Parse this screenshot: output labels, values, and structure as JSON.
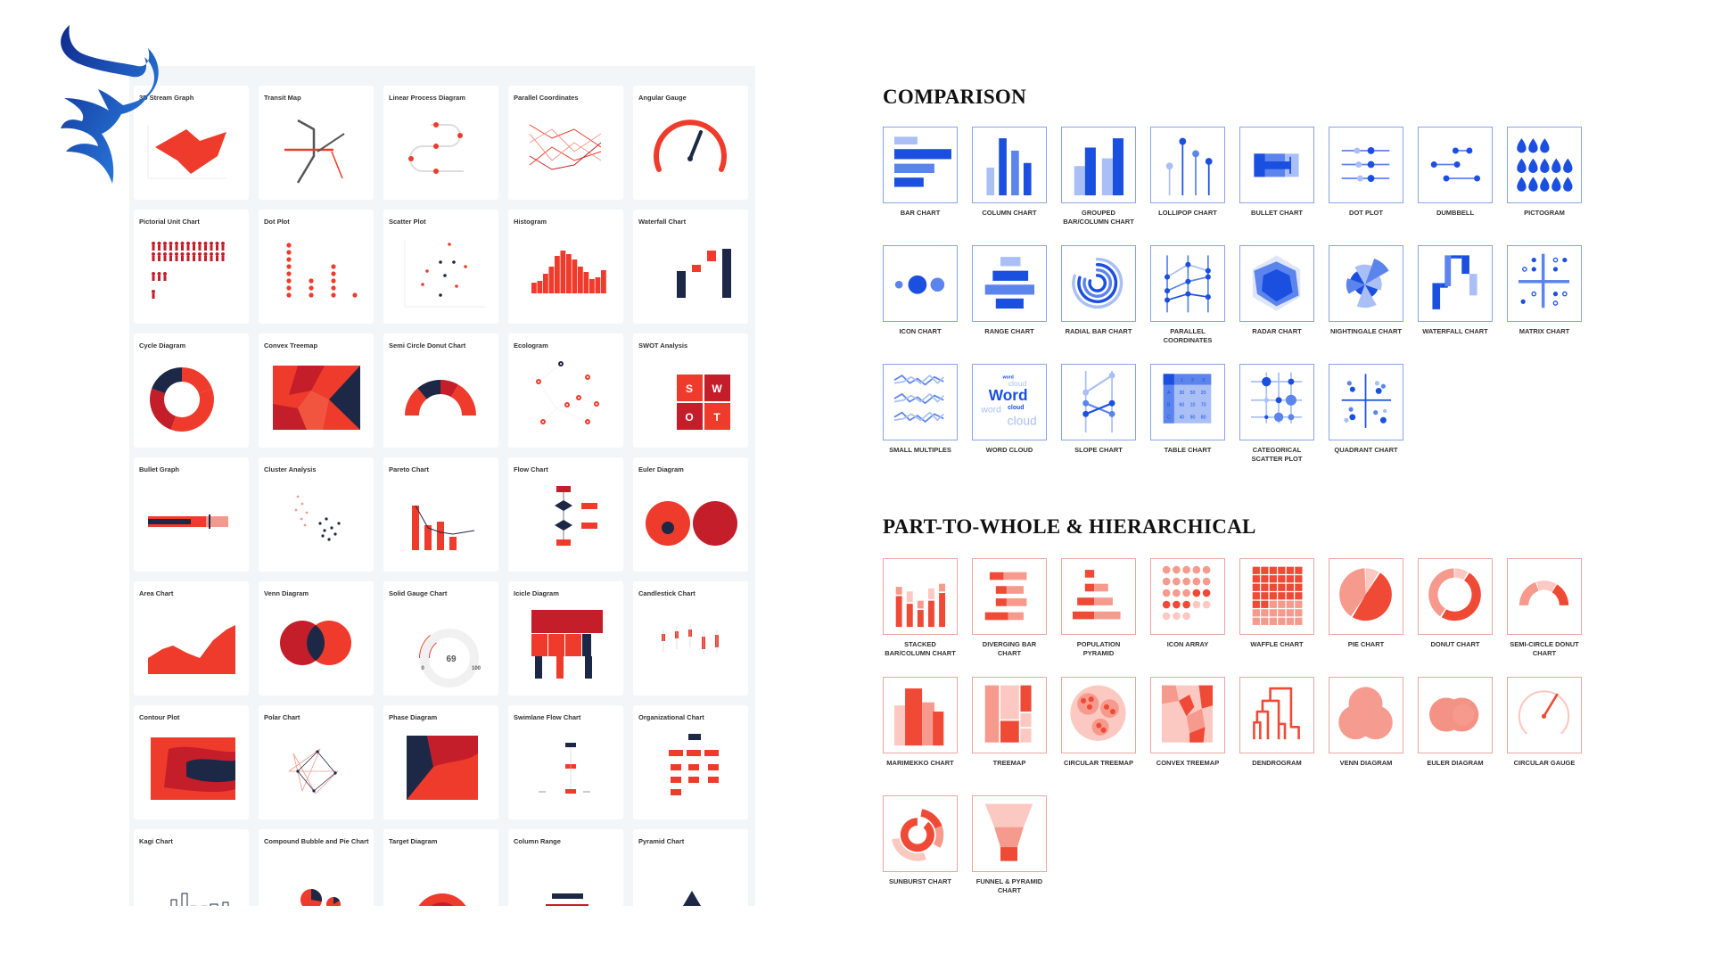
{
  "logo": {
    "icon": "blue-bull-flame-logo",
    "color_dark": "#0f2a8c",
    "color_light": "#2f8cf0"
  },
  "colors": {
    "red": "#ee3b2b",
    "dark_red": "#c41e2a",
    "navy": "#1d2846",
    "blue": "#1a4fe0",
    "blue_mid": "#5b84ec",
    "blue_light": "#a9bff5",
    "coral": "#ef4a36",
    "coral_mid": "#f59a8c",
    "coral_light": "#fbc9c1"
  },
  "gallery": {
    "cards": [
      {
        "title": "3D Stream Graph",
        "icon": "3d-stream"
      },
      {
        "title": "Transit Map",
        "icon": "transit"
      },
      {
        "title": "Linear Process Diagram",
        "icon": "linear-process"
      },
      {
        "title": "Parallel Coordinates",
        "icon": "parallel"
      },
      {
        "title": "Angular Gauge",
        "icon": "angular-gauge"
      },
      {
        "title": "Pictorial Unit Chart",
        "icon": "pictorial"
      },
      {
        "title": "Dot Plot",
        "icon": "dotplot"
      },
      {
        "title": "Scatter Plot",
        "icon": "scatter"
      },
      {
        "title": "Histogram",
        "icon": "histogram"
      },
      {
        "title": "Waterfall Chart",
        "icon": "waterfall"
      },
      {
        "title": "Cycle Diagram",
        "icon": "cycle"
      },
      {
        "title": "Convex Treemap",
        "icon": "convex"
      },
      {
        "title": "Semi Circle Donut Chart",
        "icon": "semidonut"
      },
      {
        "title": "Ecologram",
        "icon": "ecologram"
      },
      {
        "title": "SWOT Analysis",
        "icon": "swot",
        "text": [
          "S",
          "W",
          "O",
          "T"
        ]
      },
      {
        "title": "Bullet Graph",
        "icon": "bullet"
      },
      {
        "title": "Cluster Analysis",
        "icon": "cluster"
      },
      {
        "title": "Pareto Chart",
        "icon": "pareto"
      },
      {
        "title": "Flow Chart",
        "icon": "flow"
      },
      {
        "title": "Euler Diagram",
        "icon": "euler"
      },
      {
        "title": "Area Chart",
        "icon": "area"
      },
      {
        "title": "Venn Diagram",
        "icon": "venn"
      },
      {
        "title": "Solid Gauge Chart",
        "icon": "solidgauge",
        "text": [
          "69",
          "0",
          "100"
        ]
      },
      {
        "title": "Icicle Diagram",
        "icon": "icicle"
      },
      {
        "title": "Candlestick Chart",
        "icon": "candle"
      },
      {
        "title": "Contour Plot",
        "icon": "contour"
      },
      {
        "title": "Polar Chart",
        "icon": "polar"
      },
      {
        "title": "Phase Diagram",
        "icon": "phase"
      },
      {
        "title": "Swimlane Flow Chart",
        "icon": "swimlane"
      },
      {
        "title": "Organizational Chart",
        "icon": "org"
      },
      {
        "title": "Kagi Chart",
        "icon": "kagi"
      },
      {
        "title": "Compound Bubble and Pie Chart",
        "icon": "bubblepie"
      },
      {
        "title": "Target Diagram",
        "icon": "target"
      },
      {
        "title": "Column Range",
        "icon": "colrange"
      },
      {
        "title": "Pyramid Chart",
        "icon": "pyramid"
      }
    ]
  },
  "comparison": {
    "title": "COMPARISON",
    "items": [
      {
        "label": "Bar Chart",
        "icon": "bar"
      },
      {
        "label": "Column Chart",
        "icon": "column"
      },
      {
        "label": "Grouped Bar/Column Chart",
        "icon": "grouped"
      },
      {
        "label": "Lollipop Chart",
        "icon": "lollipop"
      },
      {
        "label": "Bullet Chart",
        "icon": "bulletc"
      },
      {
        "label": "Dot Plot",
        "icon": "dot"
      },
      {
        "label": "Dumbbell",
        "icon": "dumbbell"
      },
      {
        "label": "Pictogram",
        "icon": "pictogram"
      },
      {
        "label": "Icon Chart",
        "icon": "iconchart"
      },
      {
        "label": "Range Chart",
        "icon": "range"
      },
      {
        "label": "Radial Bar Chart",
        "icon": "radial"
      },
      {
        "label": "Parallel Coordinates",
        "icon": "parallelc"
      },
      {
        "label": "Radar Chart",
        "icon": "radar"
      },
      {
        "label": "Nightingale Chart",
        "icon": "nightingale"
      },
      {
        "label": "Waterfall Chart",
        "icon": "waterfallc"
      },
      {
        "label": "Matrix Chart",
        "icon": "matrix"
      },
      {
        "label": "Small Multiples",
        "icon": "multiples"
      },
      {
        "label": "Word Cloud",
        "icon": "wordcloud",
        "text": [
          "word",
          "cloud",
          "Word",
          "word",
          "cloud",
          "cloud"
        ]
      },
      {
        "label": "Slope Chart",
        "icon": "slope"
      },
      {
        "label": "Table Chart",
        "icon": "table",
        "text": [
          "1",
          "2",
          "3",
          "A",
          "30",
          "50",
          "20",
          "B",
          "60",
          "10",
          "70",
          "C",
          "40",
          "90",
          "80"
        ]
      },
      {
        "label": "Categorical Scatter Plot",
        "icon": "catscatter"
      },
      {
        "label": "Quadrant Chart",
        "icon": "quadrant"
      }
    ]
  },
  "part_to_whole": {
    "title": "PART-TO-WHOLE & HIERARCHICAL",
    "items": [
      {
        "label": "Stacked Bar/Column Chart",
        "icon": "stacked"
      },
      {
        "label": "Diverging Bar Chart",
        "icon": "diverging"
      },
      {
        "label": "Population Pyramid",
        "icon": "poppyramid"
      },
      {
        "label": "Icon Array",
        "icon": "iconarray"
      },
      {
        "label": "Waffle Chart",
        "icon": "waffle"
      },
      {
        "label": "Pie Chart",
        "icon": "pie"
      },
      {
        "label": "Donut Chart",
        "icon": "donut"
      },
      {
        "label": "Semi-Circle Donut Chart",
        "icon": "semicircle"
      },
      {
        "label": "Marimekko Chart",
        "icon": "marimekko"
      },
      {
        "label": "Treemap",
        "icon": "treemap"
      },
      {
        "label": "Circular Treemap",
        "icon": "circtreemap"
      },
      {
        "label": "Convex Treemap",
        "icon": "convexc"
      },
      {
        "label": "Dendrogram",
        "icon": "dendrogram"
      },
      {
        "label": "Venn Diagram",
        "icon": "vennc"
      },
      {
        "label": "Euler Diagram",
        "icon": "eulerc"
      },
      {
        "label": "Circular Gauge",
        "icon": "gauge"
      },
      {
        "label": "Sunburst Chart",
        "icon": "sunburst"
      },
      {
        "label": "Funnel & Pyramid Chart",
        "icon": "funnel"
      }
    ]
  }
}
